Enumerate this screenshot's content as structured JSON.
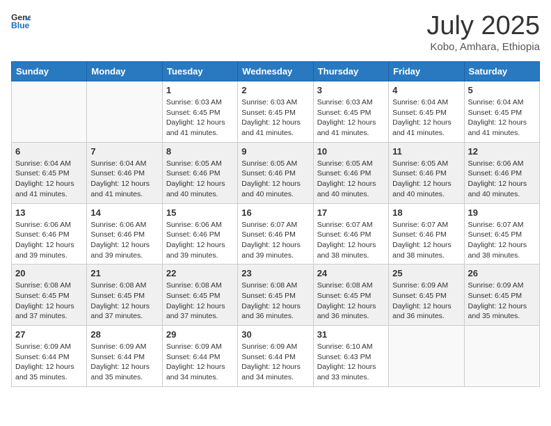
{
  "header": {
    "logo_general": "General",
    "logo_blue": "Blue",
    "month_year": "July 2025",
    "location": "Kobo, Amhara, Ethiopia"
  },
  "weekdays": [
    "Sunday",
    "Monday",
    "Tuesday",
    "Wednesday",
    "Thursday",
    "Friday",
    "Saturday"
  ],
  "weeks": [
    [
      {
        "day": "",
        "info": ""
      },
      {
        "day": "",
        "info": ""
      },
      {
        "day": "1",
        "info": "Sunrise: 6:03 AM\nSunset: 6:45 PM\nDaylight: 12 hours and 41 minutes."
      },
      {
        "day": "2",
        "info": "Sunrise: 6:03 AM\nSunset: 6:45 PM\nDaylight: 12 hours and 41 minutes."
      },
      {
        "day": "3",
        "info": "Sunrise: 6:03 AM\nSunset: 6:45 PM\nDaylight: 12 hours and 41 minutes."
      },
      {
        "day": "4",
        "info": "Sunrise: 6:04 AM\nSunset: 6:45 PM\nDaylight: 12 hours and 41 minutes."
      },
      {
        "day": "5",
        "info": "Sunrise: 6:04 AM\nSunset: 6:45 PM\nDaylight: 12 hours and 41 minutes."
      }
    ],
    [
      {
        "day": "6",
        "info": "Sunrise: 6:04 AM\nSunset: 6:45 PM\nDaylight: 12 hours and 41 minutes."
      },
      {
        "day": "7",
        "info": "Sunrise: 6:04 AM\nSunset: 6:46 PM\nDaylight: 12 hours and 41 minutes."
      },
      {
        "day": "8",
        "info": "Sunrise: 6:05 AM\nSunset: 6:46 PM\nDaylight: 12 hours and 40 minutes."
      },
      {
        "day": "9",
        "info": "Sunrise: 6:05 AM\nSunset: 6:46 PM\nDaylight: 12 hours and 40 minutes."
      },
      {
        "day": "10",
        "info": "Sunrise: 6:05 AM\nSunset: 6:46 PM\nDaylight: 12 hours and 40 minutes."
      },
      {
        "day": "11",
        "info": "Sunrise: 6:05 AM\nSunset: 6:46 PM\nDaylight: 12 hours and 40 minutes."
      },
      {
        "day": "12",
        "info": "Sunrise: 6:06 AM\nSunset: 6:46 PM\nDaylight: 12 hours and 40 minutes."
      }
    ],
    [
      {
        "day": "13",
        "info": "Sunrise: 6:06 AM\nSunset: 6:46 PM\nDaylight: 12 hours and 39 minutes."
      },
      {
        "day": "14",
        "info": "Sunrise: 6:06 AM\nSunset: 6:46 PM\nDaylight: 12 hours and 39 minutes."
      },
      {
        "day": "15",
        "info": "Sunrise: 6:06 AM\nSunset: 6:46 PM\nDaylight: 12 hours and 39 minutes."
      },
      {
        "day": "16",
        "info": "Sunrise: 6:07 AM\nSunset: 6:46 PM\nDaylight: 12 hours and 39 minutes."
      },
      {
        "day": "17",
        "info": "Sunrise: 6:07 AM\nSunset: 6:46 PM\nDaylight: 12 hours and 38 minutes."
      },
      {
        "day": "18",
        "info": "Sunrise: 6:07 AM\nSunset: 6:46 PM\nDaylight: 12 hours and 38 minutes."
      },
      {
        "day": "19",
        "info": "Sunrise: 6:07 AM\nSunset: 6:45 PM\nDaylight: 12 hours and 38 minutes."
      }
    ],
    [
      {
        "day": "20",
        "info": "Sunrise: 6:08 AM\nSunset: 6:45 PM\nDaylight: 12 hours and 37 minutes."
      },
      {
        "day": "21",
        "info": "Sunrise: 6:08 AM\nSunset: 6:45 PM\nDaylight: 12 hours and 37 minutes."
      },
      {
        "day": "22",
        "info": "Sunrise: 6:08 AM\nSunset: 6:45 PM\nDaylight: 12 hours and 37 minutes."
      },
      {
        "day": "23",
        "info": "Sunrise: 6:08 AM\nSunset: 6:45 PM\nDaylight: 12 hours and 36 minutes."
      },
      {
        "day": "24",
        "info": "Sunrise: 6:08 AM\nSunset: 6:45 PM\nDaylight: 12 hours and 36 minutes."
      },
      {
        "day": "25",
        "info": "Sunrise: 6:09 AM\nSunset: 6:45 PM\nDaylight: 12 hours and 36 minutes."
      },
      {
        "day": "26",
        "info": "Sunrise: 6:09 AM\nSunset: 6:45 PM\nDaylight: 12 hours and 35 minutes."
      }
    ],
    [
      {
        "day": "27",
        "info": "Sunrise: 6:09 AM\nSunset: 6:44 PM\nDaylight: 12 hours and 35 minutes."
      },
      {
        "day": "28",
        "info": "Sunrise: 6:09 AM\nSunset: 6:44 PM\nDaylight: 12 hours and 35 minutes."
      },
      {
        "day": "29",
        "info": "Sunrise: 6:09 AM\nSunset: 6:44 PM\nDaylight: 12 hours and 34 minutes."
      },
      {
        "day": "30",
        "info": "Sunrise: 6:09 AM\nSunset: 6:44 PM\nDaylight: 12 hours and 34 minutes."
      },
      {
        "day": "31",
        "info": "Sunrise: 6:10 AM\nSunset: 6:43 PM\nDaylight: 12 hours and 33 minutes."
      },
      {
        "day": "",
        "info": ""
      },
      {
        "day": "",
        "info": ""
      }
    ]
  ]
}
